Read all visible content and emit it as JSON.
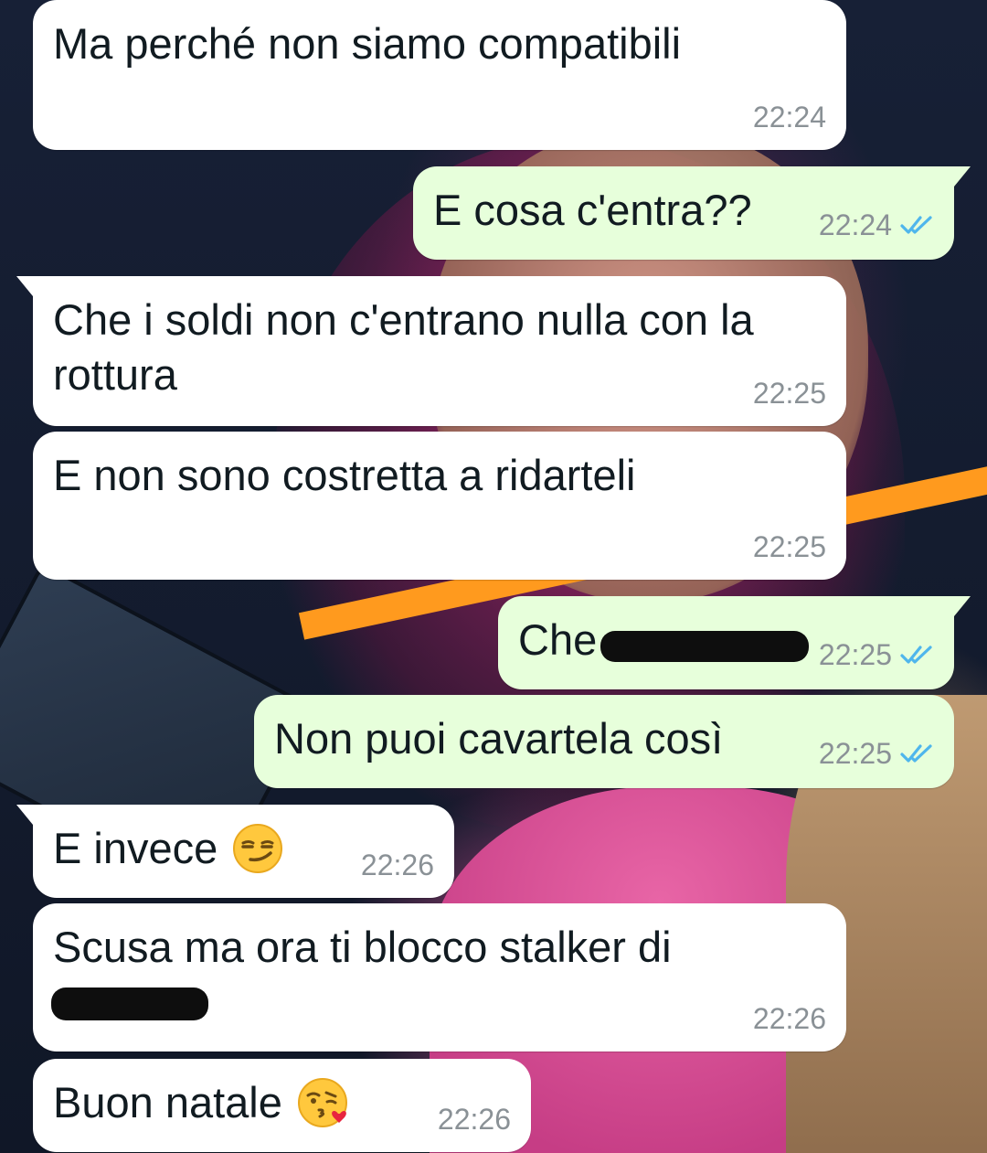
{
  "colors": {
    "incoming_bubble": "#ffffff",
    "outgoing_bubble": "#e7ffdb",
    "text": "#111b21",
    "timestamp": "#8a9196",
    "read_ticks": "#4fb6ec"
  },
  "messages": [
    {
      "direction": "incoming",
      "text": "Ma perché non siamo compatibili",
      "time": "22:24"
    },
    {
      "direction": "outgoing",
      "text": "E cosa c'entra??",
      "time": "22:24",
      "status": "read",
      "status_icon": "double-check-icon"
    },
    {
      "direction": "incoming",
      "text": "Che i soldi non c'entrano nulla con la\nrottura",
      "time": "22:25"
    },
    {
      "direction": "incoming",
      "text": "E non sono costretta a ridarteli",
      "time": "22:25"
    },
    {
      "direction": "outgoing",
      "text": "Che s",
      "redacted": true,
      "time": "22:25",
      "status": "read",
      "status_icon": "double-check-icon"
    },
    {
      "direction": "outgoing",
      "text": "Non puoi cavartela così",
      "time": "22:25",
      "status": "read",
      "status_icon": "double-check-icon"
    },
    {
      "direction": "incoming",
      "text": "E invece",
      "emoji": "smirking-face-emoji",
      "time": "22:26"
    },
    {
      "direction": "incoming",
      "text": "Scusa ma ora ti blocco stalker di\n",
      "redacted": true,
      "time": "22:26"
    },
    {
      "direction": "incoming",
      "text": "Buon natale",
      "emoji": "face-blowing-kiss-emoji",
      "time": "22:26"
    }
  ]
}
